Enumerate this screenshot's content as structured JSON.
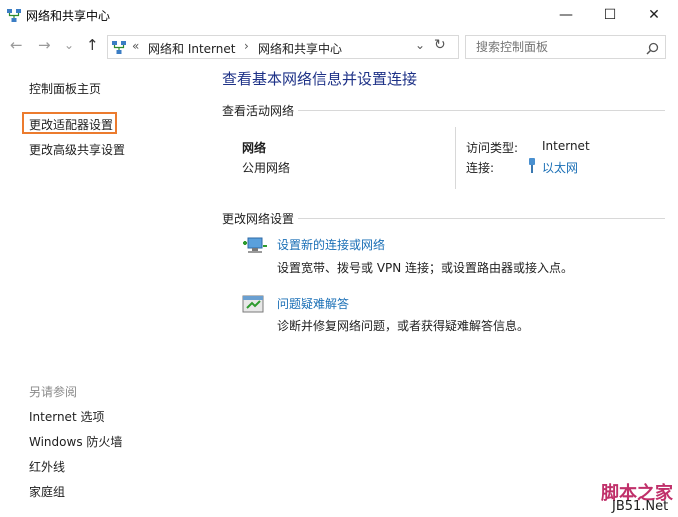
{
  "window": {
    "title": "网络和共享中心",
    "minimize": "—",
    "maximize": "☐",
    "close": "✕"
  },
  "nav": {
    "back": "←",
    "forward": "→",
    "history": "⌄",
    "up": "↑",
    "address_prefix": "«",
    "breadcrumb": [
      "网络和 Internet",
      "网络和共享中心"
    ],
    "separator": "›",
    "dropdown": "⌄",
    "refresh": "↻",
    "search_placeholder": "搜索控制面板"
  },
  "sidebar": {
    "home": "控制面板主页",
    "items": [
      "更改适配器设置",
      "更改高级共享设置"
    ],
    "see_also_label": "另请参阅",
    "see_also": [
      "Internet 选项",
      "Windows 防火墙",
      "红外线",
      "家庭组"
    ]
  },
  "main": {
    "title": "查看基本网络信息并设置连接",
    "active_networks_label": "查看活动网络",
    "network": {
      "name": "网络",
      "type": "公用网络",
      "access_type_label": "访问类型:",
      "access_type_value": "Internet",
      "connections_label": "连接:",
      "connections_value": "以太网"
    },
    "change_settings_label": "更改网络设置",
    "tasks": [
      {
        "link": "设置新的连接或网络",
        "desc": "设置宽带、拨号或 VPN 连接；或设置路由器或接入点。"
      },
      {
        "link": "问题疑难解答",
        "desc": "诊断并修复网络问题，或者获得疑难解答信息。"
      }
    ]
  },
  "watermark": {
    "line1": "脚本之家",
    "line2": "JB51.Net"
  },
  "colors": {
    "highlight": "#ec7b2e",
    "title_blue": "#1e3287",
    "link_blue": "#1a6fb6"
  }
}
